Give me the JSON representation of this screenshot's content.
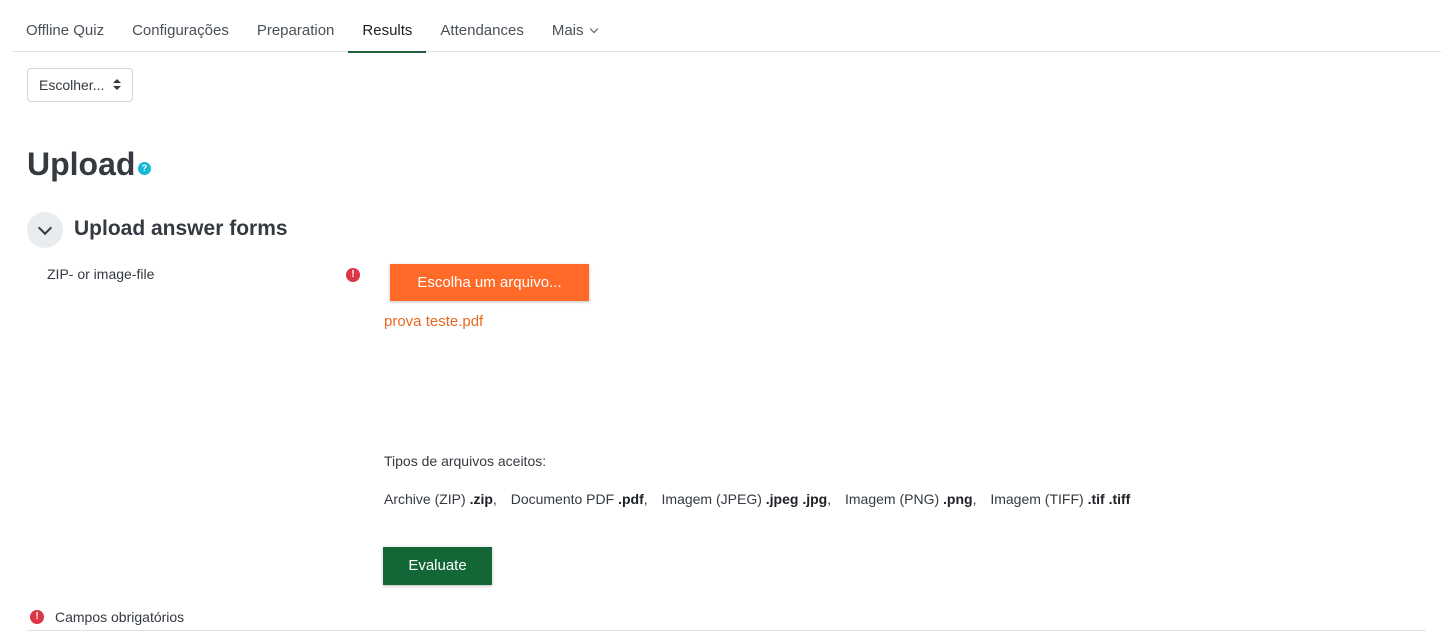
{
  "nav": {
    "tabs": [
      {
        "label": "Offline Quiz"
      },
      {
        "label": "Configurações"
      },
      {
        "label": "Preparation"
      },
      {
        "label": "Results"
      },
      {
        "label": "Attendances"
      },
      {
        "label": "Mais"
      }
    ],
    "active_tab": "Results"
  },
  "selector": {
    "value": "Escolher..."
  },
  "page": {
    "title": "Upload",
    "help_glyph": "?"
  },
  "section": {
    "title": "Upload answer forms"
  },
  "form": {
    "field_label": "ZIP- or image-file",
    "required_glyph": "!",
    "choose_button": "Escolha um arquivo...",
    "file_name": "prova teste.pdf",
    "accepted_label": "Tipos de arquivos aceitos:",
    "accepted_types": [
      {
        "name": "Archive (ZIP)",
        "ext": ".zip"
      },
      {
        "name": "Documento PDF",
        "ext": ".pdf"
      },
      {
        "name": "Imagem (JPEG)",
        "ext": ".jpeg .jpg"
      },
      {
        "name": "Imagem (PNG)",
        "ext": ".png"
      },
      {
        "name": "Imagem (TIFF)",
        "ext": ".tif .tiff"
      }
    ],
    "evaluate_button": "Evaluate"
  },
  "footer": {
    "required_text": "Campos obrigatórios"
  },
  "colors": {
    "primary": "#136635",
    "file_button": "#ff6a28",
    "file_link": "#e8691f",
    "required": "#dc3545",
    "help": "#14b8d9"
  },
  "icons": [
    "chevron-down-icon",
    "sort-caret-icon",
    "help-icon",
    "required-icon"
  ]
}
